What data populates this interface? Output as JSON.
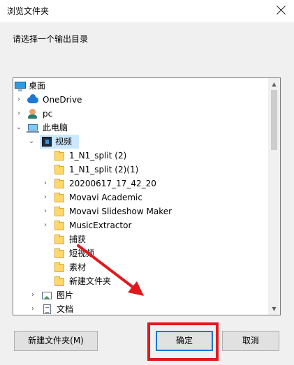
{
  "window": {
    "title": "浏览文件夹"
  },
  "instruction": "请选择一个输出目录",
  "tree": {
    "desktop": "桌面",
    "onedrive": "OneDrive",
    "pc": "pc",
    "this_pc": "此电脑",
    "videos": "视频",
    "folder_1": "1_N1_split (2)",
    "folder_2": "1_N1_split (2)(1)",
    "folder_3": "20200617_17_42_20",
    "folder_4": "Movavi Academic",
    "folder_5": "Movavi Slideshow Maker",
    "folder_6": "MusicExtractor",
    "folder_7": "捕获",
    "folder_8": "短视频",
    "folder_9": "素材",
    "folder_10": "新建文件夹",
    "pictures": "图片",
    "documents": "文档"
  },
  "buttons": {
    "new_folder": "新建文件夹(M)",
    "ok": "确定",
    "cancel": "取消"
  },
  "colors": {
    "selection": "#cce8ff",
    "primary_border": "#0078d7",
    "annotation": "#e0191d"
  }
}
